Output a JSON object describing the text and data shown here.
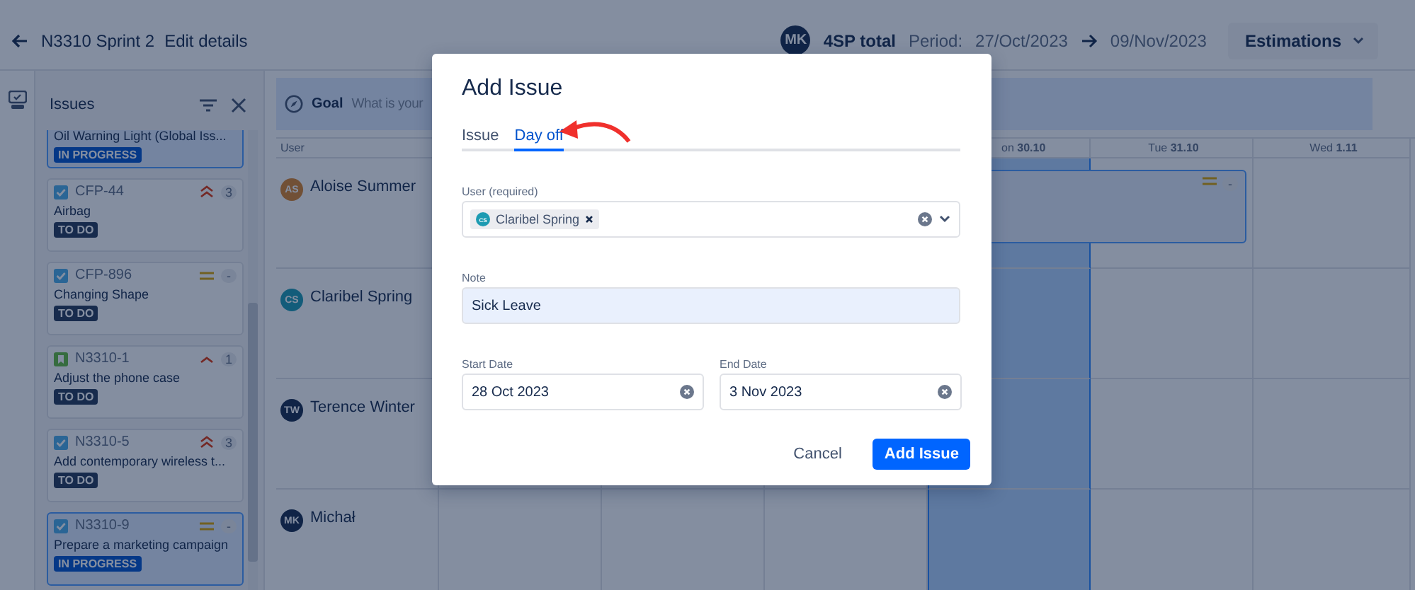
{
  "header": {
    "sprint": "N3310 Sprint 2",
    "edit_link": "Edit details",
    "avatar": "MK",
    "total": "4SP total",
    "period_label": "Period:",
    "start": "27/Oct/2023",
    "end": "09/Nov/2023",
    "menu": "Estimations"
  },
  "sidebar": {
    "title": "Issues",
    "cards": [
      {
        "title": "Oil Warning Light (Global Iss...",
        "status": "IN PROGRESS",
        "selected": true
      },
      {
        "kind": "task",
        "key": "CFP-44",
        "priority": {
          "kind": "highest"
        },
        "points": "3",
        "title": "Airbag",
        "status": "TO DO",
        "selected": false
      },
      {
        "kind": "task",
        "key": "CFP-896",
        "priority": {
          "kind": "medium"
        },
        "points": "-",
        "title": "Changing Shape",
        "status": "TO DO",
        "selected": false
      },
      {
        "kind": "story",
        "key": "N3310-1",
        "priority": {
          "kind": "high"
        },
        "points": "1",
        "title": "Adjust the phone case",
        "status": "TO DO",
        "selected": false
      },
      {
        "kind": "task",
        "key": "N3310-5",
        "priority": {
          "kind": "highest"
        },
        "points": "3",
        "title": "Add contemporary wireless t...",
        "status": "TO DO",
        "selected": false
      },
      {
        "kind": "task",
        "key": "N3310-9",
        "priority": {
          "kind": "medium"
        },
        "points": "-",
        "title": "Prepare a marketing campaign",
        "status": "IN PROGRESS",
        "selected": true
      }
    ]
  },
  "goal": {
    "label": "Goal",
    "placeholder": "What is your"
  },
  "calendar": {
    "user_column": "User",
    "days": [
      {
        "label": "on **30.10**",
        "today": true
      },
      {
        "label": "Tue **31.10**",
        "today": false
      },
      {
        "label": "Wed **1.11**",
        "today": false
      }
    ],
    "users": [
      {
        "initials": "AS",
        "name": "Aloise Summer"
      },
      {
        "initials": "CS",
        "name": "Claribel Spring"
      },
      {
        "initials": "TW",
        "name": "Terence Winter"
      },
      {
        "initials": "MK",
        "name": "Michał"
      }
    ],
    "issue": {
      "priority": {
        "kind": "medium"
      },
      "points": "-"
    }
  },
  "dialog": {
    "title": "Add Issue",
    "tabs": [
      {
        "label": "Issue",
        "selected": false
      },
      {
        "label": "Day off",
        "selected": true
      }
    ],
    "user_label": "User (required)",
    "user_value": {
      "initials": "CS",
      "name": "Claribel Spring"
    },
    "note_label": "Note",
    "note_value": "Sick Leave",
    "start_label": "Start Date",
    "start_value": "28 Oct 2023",
    "end_label": "End Date",
    "end_value": "3 Nov 2023",
    "buttons": [
      {
        "label": "Cancel",
        "kind": "subtle"
      },
      {
        "label": "Add Issue",
        "kind": "primary"
      }
    ]
  }
}
